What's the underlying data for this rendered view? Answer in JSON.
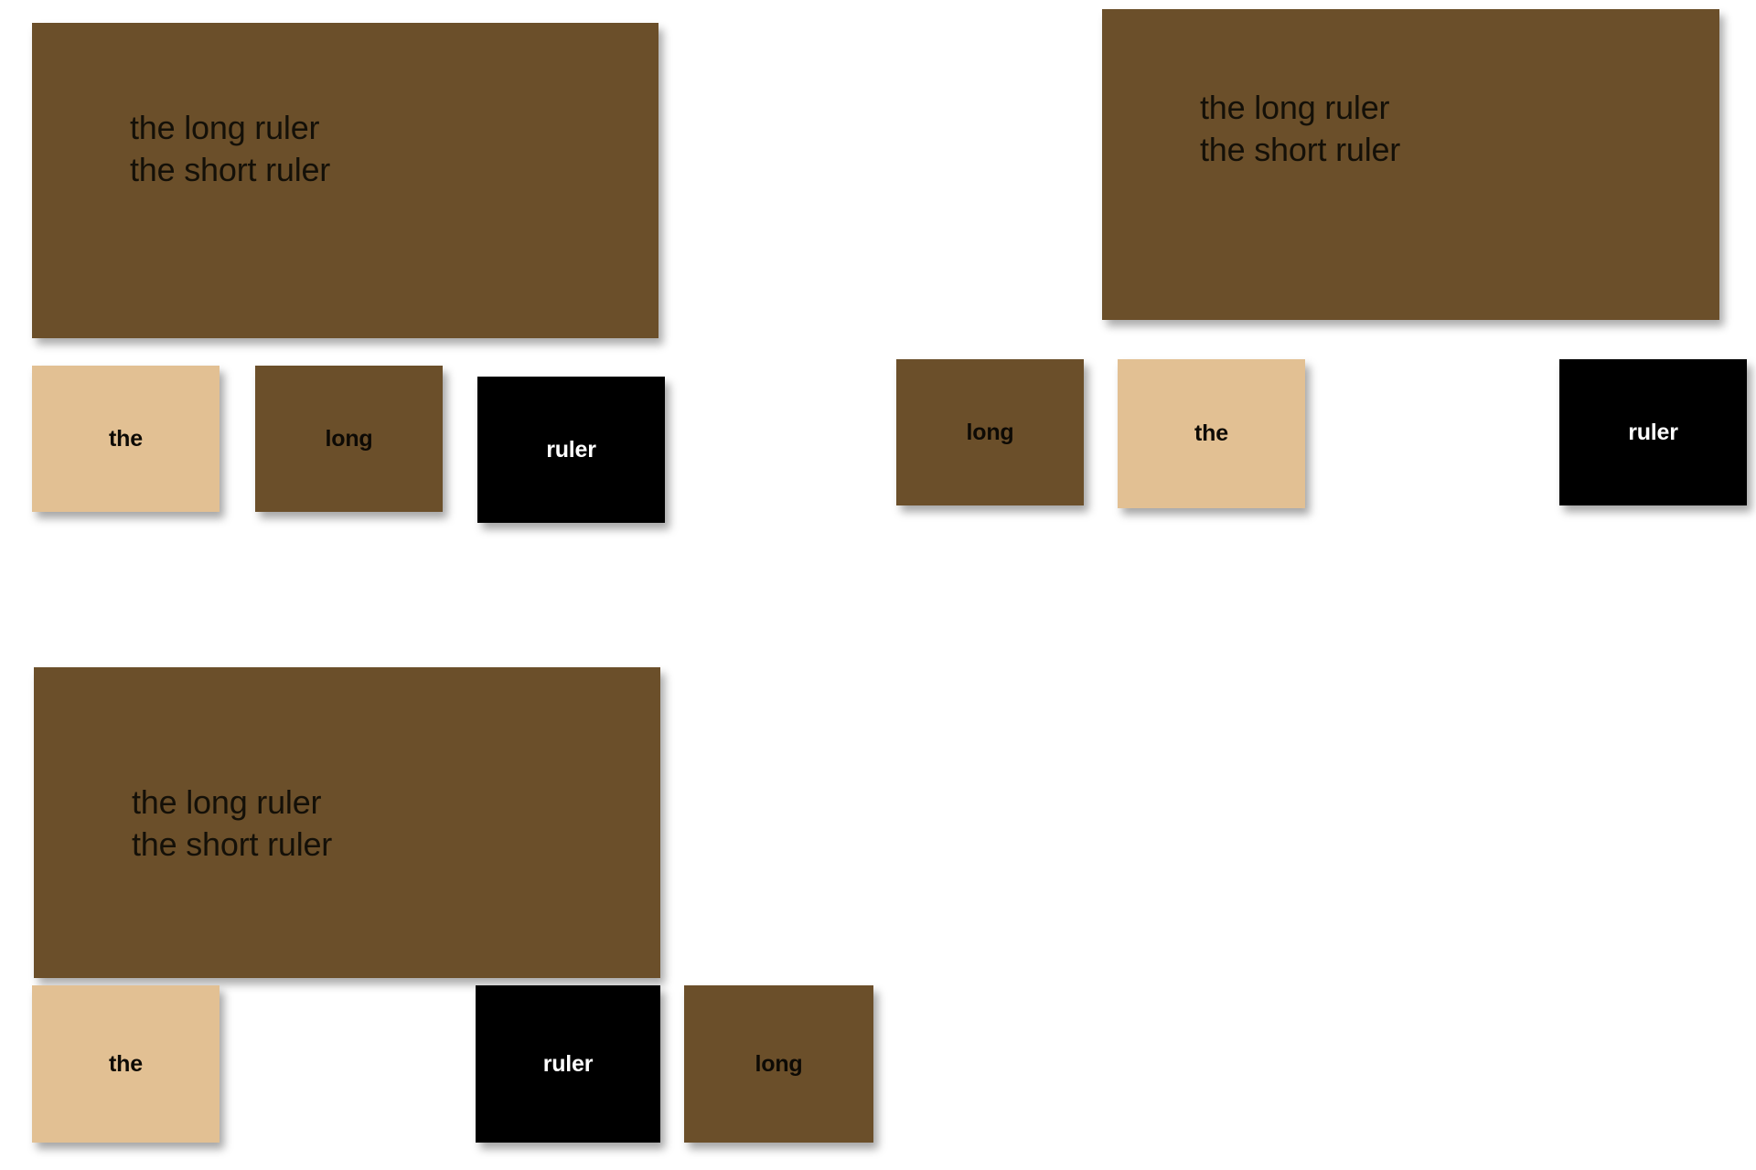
{
  "sentence_panels": [
    {
      "id": "top-left",
      "line1": "the long ruler",
      "line2": "the short ruler",
      "text": "the long ruler\nthe short ruler",
      "background_color": "#6b4f2a",
      "text_color": "#141008"
    },
    {
      "id": "top-right",
      "line1": "the long ruler",
      "line2": "the short ruler",
      "text": "the long ruler\nthe short ruler",
      "background_color": "#6b4f2a",
      "text_color": "#141008"
    },
    {
      "id": "bottom-left",
      "line1": "the long ruler",
      "line2": "the short ruler",
      "text": "the long ruler\nthe short ruler",
      "background_color": "#6b4f2a",
      "text_color": "#141008"
    }
  ],
  "word_rows": [
    {
      "id": "row-top-left",
      "cards": [
        {
          "label": "the",
          "color_name": "tan",
          "background_color": "#e2c093",
          "text_color": "#0d0a05"
        },
        {
          "label": "long",
          "color_name": "brown",
          "background_color": "#6b4f2a",
          "text_color": "#0d0a05"
        },
        {
          "label": "ruler",
          "color_name": "black",
          "background_color": "#000000",
          "text_color": "#ffffff"
        }
      ]
    },
    {
      "id": "row-top-right",
      "cards": [
        {
          "label": "long",
          "color_name": "brown",
          "background_color": "#6b4f2a",
          "text_color": "#0d0a05"
        },
        {
          "label": "the",
          "color_name": "tan",
          "background_color": "#e2c093",
          "text_color": "#0d0a05"
        },
        {
          "label": "ruler",
          "color_name": "black",
          "background_color": "#000000",
          "text_color": "#ffffff"
        }
      ]
    },
    {
      "id": "row-bottom-left",
      "cards": [
        {
          "label": "the",
          "color_name": "tan",
          "background_color": "#e2c093",
          "text_color": "#0d0a05"
        },
        {
          "label": "ruler",
          "color_name": "black",
          "background_color": "#000000",
          "text_color": "#ffffff"
        },
        {
          "label": "long",
          "color_name": "brown",
          "background_color": "#6b4f2a",
          "text_color": "#0d0a05"
        }
      ]
    }
  ],
  "palette": {
    "brown": "#6b4f2a",
    "tan": "#e2c093",
    "black": "#000000",
    "white": "#ffffff",
    "panel_text": "#141008"
  }
}
